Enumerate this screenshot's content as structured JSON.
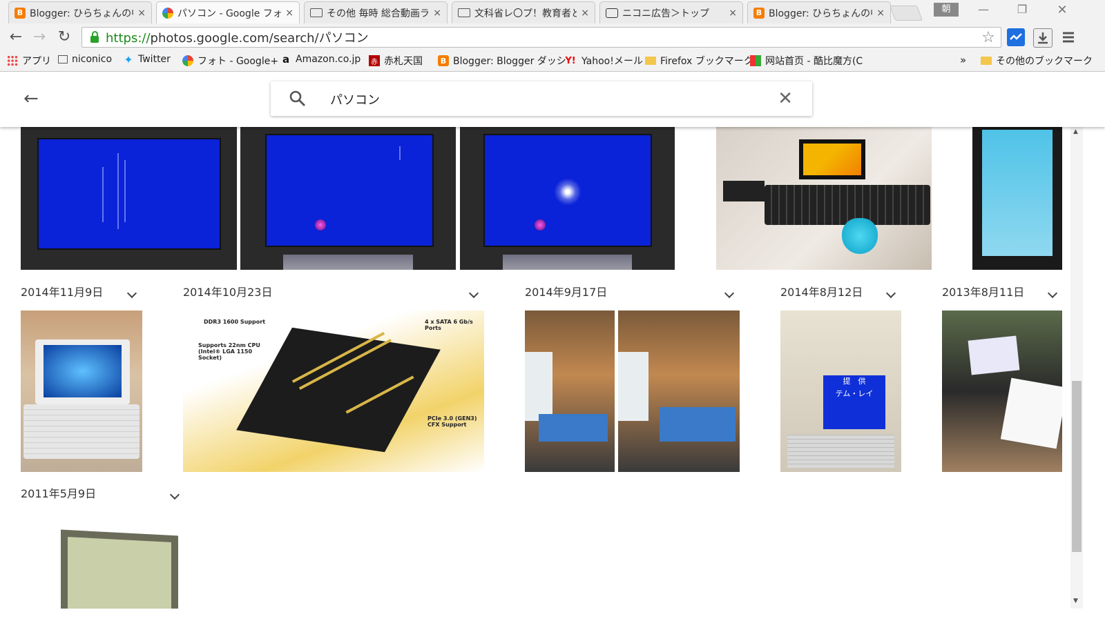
{
  "tabs": [
    {
      "title": "Blogger: ひらちょんの中ェ",
      "icon": "blogger-icon",
      "active": false
    },
    {
      "title": "パソコン - Google フォト",
      "icon": "google-photos-icon",
      "active": true
    },
    {
      "title": "その他 毎時 総合動画ラ",
      "icon": "niconico-icon",
      "active": false
    },
    {
      "title": "文科省レ〇プ！教育者と",
      "icon": "niconico-icon",
      "active": false
    },
    {
      "title": "ニコニ広告＞トップ",
      "icon": "nicoad-icon",
      "active": false
    },
    {
      "title": "Blogger: ひらちょんの中ェ",
      "icon": "blogger-icon",
      "active": false
    }
  ],
  "tab_close": "×",
  "ime_indicator": "朝",
  "window": {
    "minimize": "—",
    "restore": "❐",
    "close": "✕"
  },
  "toolbar": {
    "back": "←",
    "forward": "→",
    "reload": "↻",
    "url_scheme": "https://",
    "url_rest": "photos.google.com/search/パソコン",
    "star": "☆"
  },
  "bookmarks": [
    {
      "label": "アプリ",
      "icon": "apps-grid-icon"
    },
    {
      "label": "niconico",
      "icon": "niconico-icon"
    },
    {
      "label": "Twitter",
      "icon": "twitter-bird-icon"
    },
    {
      "label": "フォト - Google+",
      "icon": "google-photos-icon"
    },
    {
      "label": "Amazon.co.jp",
      "icon": "amazon-icon"
    },
    {
      "label": "赤札天国",
      "icon": "akafuda-icon"
    },
    {
      "label": "Blogger: Blogger ダッシ",
      "icon": "blogger-icon"
    },
    {
      "label": "Yahoo!メール",
      "icon": "yahoo-icon"
    },
    {
      "label": "Firefox ブックマーク",
      "icon": "folder-icon"
    },
    {
      "label": "网站首页 - 酷比魔方(C",
      "icon": "site-icon"
    }
  ],
  "bookmarks_more": "»",
  "bookmarks_other": "その他のブックマーク",
  "search": {
    "query": "パソコン",
    "back": "←",
    "clear": "✕"
  },
  "date_groups": [
    "2014年11月9日",
    "2014年10月23日",
    "2014年9月17日",
    "2014年8月12日",
    "2013年8月11日",
    "2011年5月9日"
  ],
  "photo_text": {
    "mobo_ddr3": "DDR3 1600 Support",
    "mobo_cpu": "Supports 22nm CPU (Intel® LGA 1150 Socket)",
    "mobo_sata": "4 x SATA 6 Gb/s Ports",
    "mobo_pcie": "PCIe 3.0 (GEN3) CFX Support",
    "screen_title": "提　供",
    "screen_sub": "テム・レイ"
  },
  "scrollbar": {
    "up": "▲",
    "down": "▼"
  }
}
